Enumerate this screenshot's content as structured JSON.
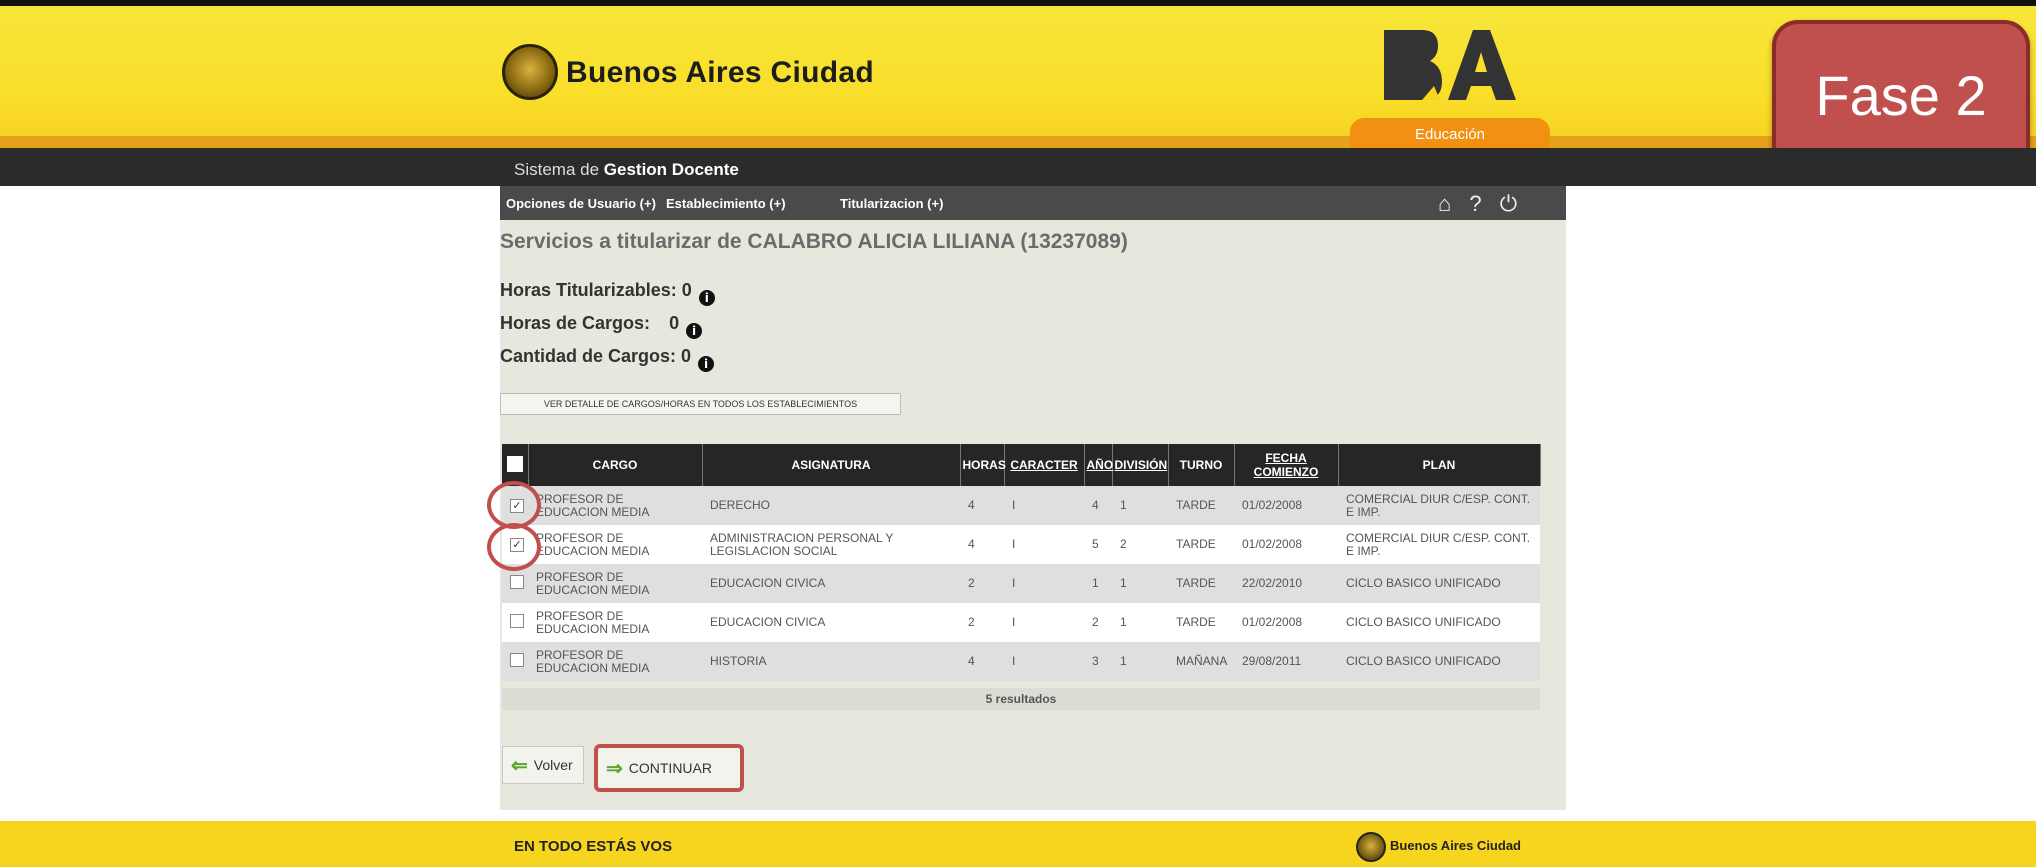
{
  "header": {
    "brand_name": "Buenos Aires Ciudad",
    "logo_text": "BA",
    "section_tab": "Educación",
    "overlay_badge": "Fase 2",
    "system_title_prefix": "Sistema de",
    "system_title_bold": "Gestion Docente"
  },
  "nav": {
    "items": [
      "Opciones de Usuario (+)",
      "Establecimiento (+)",
      "Titularizacion (+)"
    ],
    "icons": [
      "home-icon",
      "help-icon",
      "power-icon"
    ],
    "icons_text": "⌂ ? ⏻"
  },
  "main": {
    "title": "Servicios a titularizar de CALABRO ALICIA LILIANA (13237089)",
    "stats": [
      {
        "label": "Horas Titularizables:",
        "value": "0"
      },
      {
        "label": "Horas de Cargos:",
        "value": "0"
      },
      {
        "label": "Cantidad de Cargos:",
        "value": "0"
      }
    ],
    "detail_button": "VER DETALLE DE CARGOS/HORAS EN TODOS LOS ESTABLECIMIENTOS"
  },
  "table": {
    "columns": [
      "CARGO",
      "ASIGNATURA",
      "HORAS",
      "CARACTER",
      "AÑO",
      "DIVISIÓN",
      "TURNO",
      "FECHA COMIENZO",
      "PLAN"
    ],
    "rows": [
      {
        "checked": true,
        "cargo": "PROFESOR DE EDUCACION MEDIA",
        "asignatura": "DERECHO",
        "horas": "4",
        "caracter": "I",
        "anio": "4",
        "division": "1",
        "turno": "TARDE",
        "fecha": "01/02/2008",
        "plan": "COMERCIAL DIUR C/ESP. CONT. E IMP."
      },
      {
        "checked": true,
        "cargo": "PROFESOR DE EDUCACION MEDIA",
        "asignatura": "ADMINISTRACION PERSONAL Y LEGISLACION SOCIAL",
        "horas": "4",
        "caracter": "I",
        "anio": "5",
        "division": "2",
        "turno": "TARDE",
        "fecha": "01/02/2008",
        "plan": "COMERCIAL DIUR C/ESP. CONT. E IMP."
      },
      {
        "checked": false,
        "cargo": "PROFESOR DE EDUCACION MEDIA",
        "asignatura": "EDUCACION CIVICA",
        "horas": "2",
        "caracter": "I",
        "anio": "1",
        "division": "1",
        "turno": "TARDE",
        "fecha": "22/02/2010",
        "plan": "CICLO BASICO UNIFICADO"
      },
      {
        "checked": false,
        "cargo": "PROFESOR DE EDUCACION MEDIA",
        "asignatura": "EDUCACION CIVICA",
        "horas": "2",
        "caracter": "I",
        "anio": "2",
        "division": "1",
        "turno": "TARDE",
        "fecha": "01/02/2008",
        "plan": "CICLO BASICO UNIFICADO"
      },
      {
        "checked": false,
        "cargo": "PROFESOR DE EDUCACION MEDIA",
        "asignatura": "HISTORIA",
        "horas": "4",
        "caracter": "I",
        "anio": "3",
        "division": "1",
        "turno": "MAÑANA",
        "fecha": "29/08/2011",
        "plan": "CICLO BASICO UNIFICADO"
      }
    ],
    "results_label": "5 resultados"
  },
  "actions": {
    "back_label": "Volver",
    "continue_label": "CONTINUAR"
  },
  "footer": {
    "slogan": "EN TODO ESTÁS VOS",
    "brand": "Buenos Aires Ciudad"
  },
  "colors": {
    "header_yellow": "#f9de2a",
    "header_orange": "#e6a11c",
    "tab_orange": "#f19013",
    "annotation_red": "#c0504d",
    "dark_bar": "#2b2b2b",
    "panel_bg": "#e8e7dd"
  }
}
